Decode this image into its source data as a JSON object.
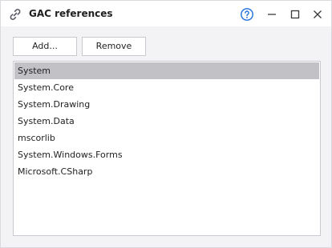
{
  "window": {
    "title": "GAC references",
    "icons": {
      "title": "link-icon",
      "help": "help-icon",
      "minimize": "minimize-icon",
      "maximize": "maximize-icon",
      "close": "close-icon"
    },
    "colors": {
      "accent": "#1e6fd9",
      "selection": "#c2c2c6"
    }
  },
  "toolbar": {
    "add_label": "Add...",
    "remove_label": "Remove"
  },
  "references": {
    "items": [
      {
        "label": "System",
        "selected": true
      },
      {
        "label": "System.Core",
        "selected": false
      },
      {
        "label": "System.Drawing",
        "selected": false
      },
      {
        "label": "System.Data",
        "selected": false
      },
      {
        "label": "mscorlib",
        "selected": false
      },
      {
        "label": "System.Windows.Forms",
        "selected": false
      },
      {
        "label": "Microsoft.CSharp",
        "selected": false
      }
    ]
  }
}
